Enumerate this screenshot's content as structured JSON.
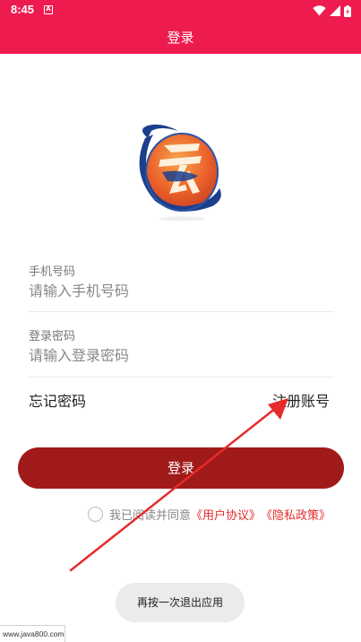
{
  "statusbar": {
    "time": "8:45",
    "notification": "A"
  },
  "appbar": {
    "title": "登录"
  },
  "form": {
    "phone_label": "手机号码",
    "phone_placeholder": "请输入手机号码",
    "password_label": "登录密码",
    "password_placeholder": "请输入登录密码",
    "forgot_password": "忘记密码",
    "register": "注册账号",
    "login_button": "登录"
  },
  "agreement": {
    "prefix": "我已阅读并同意",
    "user_agreement": "《用户协议》",
    "privacy_policy": "《隐私政策》",
    "checked": false
  },
  "toast": {
    "text": "再按一次退出应用"
  },
  "watermark": {
    "text": "www.java800.com"
  },
  "colors": {
    "primary": "#ee1b4f",
    "button": "#a11a1a",
    "link": "#e52c2c",
    "annotation_arrow": "#e62b2b"
  }
}
